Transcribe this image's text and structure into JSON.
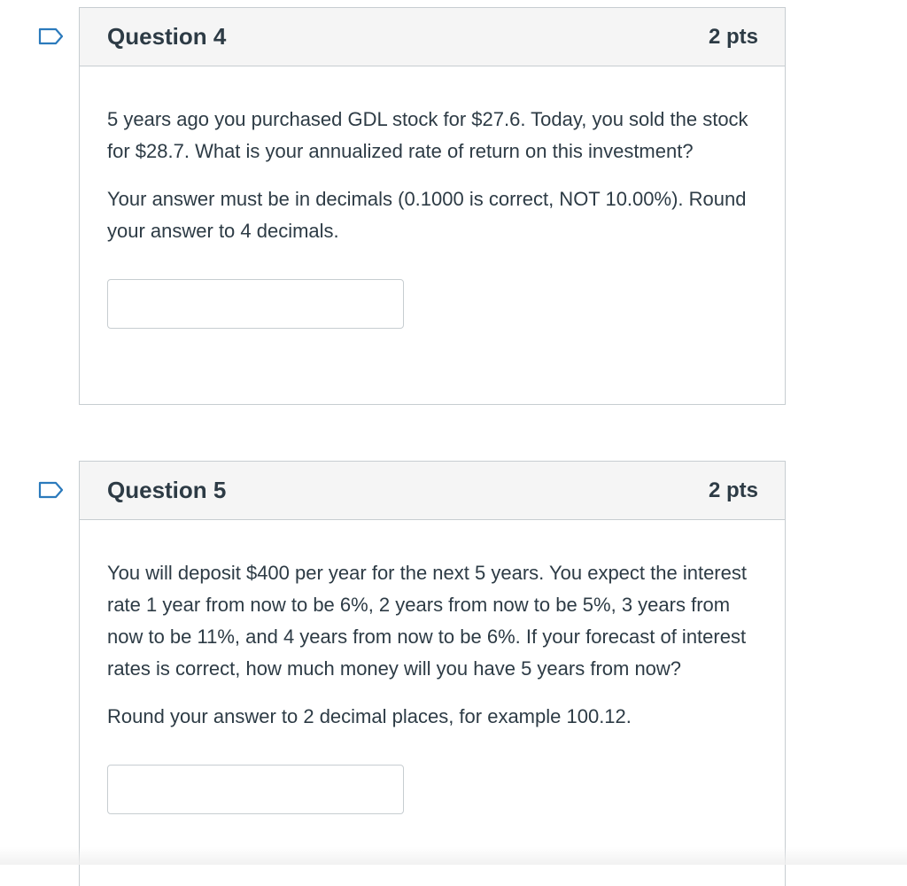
{
  "questions": [
    {
      "title": "Question 4",
      "points": "2 pts",
      "paragraphs": [
        "5 years ago you purchased GDL stock for $27.6. Today, you sold the stock for $28.7. What is your annualized rate of return on this investment?",
        "Your answer must be in decimals (0.1000 is correct, NOT 10.00%). Round your answer to 4 decimals."
      ],
      "answer_value": ""
    },
    {
      "title": "Question 5",
      "points": "2 pts",
      "paragraphs": [
        "You will deposit $400 per year for the next 5 years. You expect the interest rate 1 year from now to be 6%, 2 years from now to be 5%, 3 years from now to be 11%, and 4 years from now to be 6%. If your forecast of interest rates is correct, how much money will you have 5 years from now?",
        "Round your answer to 2 decimal places, for example 100.12."
      ],
      "answer_value": ""
    }
  ],
  "colors": {
    "flag_outline": "#2b7abc",
    "header_bg": "#f5f5f5",
    "border": "#c7cdd1",
    "text": "#2d3b45"
  },
  "icons": {
    "flag": "bookmark-flag-icon"
  }
}
